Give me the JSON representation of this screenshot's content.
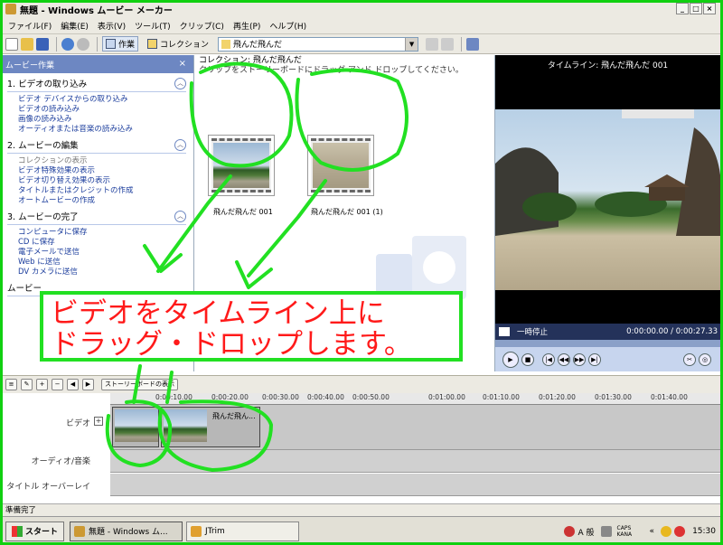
{
  "window": {
    "title": "無題 - Windows ムービー メーカー",
    "min": "_",
    "max": "□",
    "close": "×"
  },
  "menu": [
    "ファイル(F)",
    "編集(E)",
    "表示(V)",
    "ツール(T)",
    "クリップ(C)",
    "再生(P)",
    "ヘルプ(H)"
  ],
  "toolbar": {
    "tasks_label": "作業",
    "collections_label": "コレクション",
    "collection_value": "飛んだ飛んだ"
  },
  "taskpane": {
    "header": "ムービー作業",
    "close": "×",
    "sections": [
      {
        "title": "1. ビデオの取り込み",
        "links": [
          "ビデオ デバイスからの取り込み",
          "ビデオの読み込み",
          "画像の読み込み",
          "オーディオまたは音楽の読み込み"
        ]
      },
      {
        "title": "2. ムービーの編集",
        "links": [
          "コレクションの表示",
          "ビデオ特殊効果の表示",
          "ビデオ切り替え効果の表示",
          "タイトルまたはクレジットの作成",
          "オートムービーの作成"
        ]
      },
      {
        "title": "3. ムービーの完了",
        "links": [
          "コンピュータに保存",
          "CD に保存",
          "電子メールで送信",
          "Web に送信",
          "DV カメラに送信"
        ]
      },
      {
        "title": "ムービー"
      }
    ]
  },
  "collection": {
    "title": "コレクション: 飛んだ飛んだ",
    "hint": "クリップをストーリーボードにドラッグ アンド ドロップしてください。",
    "clips": [
      {
        "name": "飛んだ飛んだ 001"
      },
      {
        "name": "飛んだ飛んだ 001 (1)"
      }
    ]
  },
  "monitor": {
    "title": "タイムライン: 飛んだ飛んだ 001",
    "status": "一時停止",
    "time": "0:00:00.00 / 0:00:27.33"
  },
  "timeline": {
    "toggle_label": "ストーリーボードの表示",
    "ticks": [
      "0:00:10.00",
      "0:00:20.00",
      "0:00:30.00",
      "0:00:40.00",
      "0:00:50.00",
      "0:01:00.00",
      "0:01:10.00",
      "0:01:20.00",
      "0:01:30.00",
      "0:01:40.00"
    ],
    "tracks": {
      "video": "ビデオ",
      "audio": "オーディオ/音楽",
      "title": "タイトル オーバーレイ"
    },
    "clip_name": "飛んだ飛ん..."
  },
  "statusbar": {
    "text": "準備完了"
  },
  "taskbar": {
    "start": "スタート",
    "tasks": [
      "無題 - Windows ム...",
      "JTrim"
    ],
    "tray": {
      "ime": "A 般",
      "caps": "CAPS KANA",
      "clock": "15:30",
      "chev": "«"
    }
  },
  "annotation": {
    "line1": "ビデオをタイムライン上に",
    "line2": "ドラッグ・ドロップします。",
    "color": "#ff1a1a",
    "outline_color": "#22e022"
  }
}
